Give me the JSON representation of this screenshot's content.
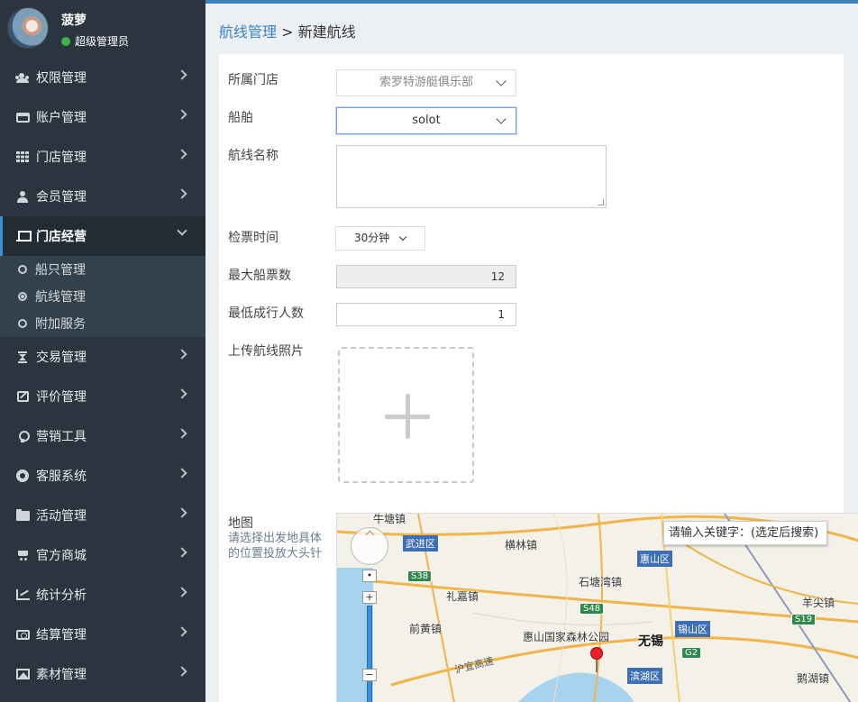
{
  "profile": {
    "name": "菠萝",
    "role": "超级管理员"
  },
  "sidebar": {
    "items": [
      {
        "label": "权限管理",
        "icon": "users-icon"
      },
      {
        "label": "账户管理",
        "icon": "card-icon"
      },
      {
        "label": "门店管理",
        "icon": "grid-icon"
      },
      {
        "label": "会员管理",
        "icon": "user-icon"
      },
      {
        "label": "门店经营",
        "icon": "laptop-icon",
        "expanded": true
      },
      {
        "label": "交易管理",
        "icon": "hourglass-icon"
      },
      {
        "label": "评价管理",
        "icon": "edit-icon"
      },
      {
        "label": "营销工具",
        "icon": "bulb-icon"
      },
      {
        "label": "客服系统",
        "icon": "lifebuoy-icon"
      },
      {
        "label": "活动管理",
        "icon": "folder-icon"
      },
      {
        "label": "官方商城",
        "icon": "cart-icon"
      },
      {
        "label": "统计分析",
        "icon": "chart-icon"
      },
      {
        "label": "结算管理",
        "icon": "money-icon"
      },
      {
        "label": "素材管理",
        "icon": "image-icon"
      }
    ],
    "subitems": [
      {
        "label": "船只管理",
        "selected": false
      },
      {
        "label": "航线管理",
        "selected": true
      },
      {
        "label": "附加服务",
        "selected": false
      }
    ]
  },
  "breadcrumb": {
    "parent": "航线管理",
    "separator": ">",
    "current": "新建航线"
  },
  "form": {
    "store": {
      "label": "所属门店",
      "value": "索罗特游艇俱乐部"
    },
    "boat": {
      "label": "船舶",
      "value": "solot"
    },
    "route_name": {
      "label": "航线名称",
      "value": ""
    },
    "check_time": {
      "label": "检票时间",
      "value": "30分钟"
    },
    "max_tickets": {
      "label": "最大船票数",
      "value": "12"
    },
    "min_people": {
      "label": "最低成行人数",
      "value": "1"
    },
    "photo": {
      "label": "上传航线照片"
    },
    "map": {
      "label": "地图",
      "hint": "请选择出发地具体的位置投放大头针"
    }
  },
  "map": {
    "search_placeholder": "请输入关键字：(选定后搜索)",
    "labels": [
      "牛塘镇",
      "横林镇",
      "石塘湾镇",
      "礼嘉镇",
      "前黄镇",
      "惠山国家森林公园",
      "无锡",
      "羊尖镇",
      "鹅湖镇"
    ],
    "districts": [
      "武进区",
      "惠山区",
      "锡山区",
      "滨湖区"
    ],
    "shields": [
      "S38",
      "S48",
      "S19",
      "G2"
    ],
    "road": "沪宜高速",
    "zoom_in": "+",
    "zoom_out": "−"
  },
  "colors": {
    "sidebar_bg": "#2a353f",
    "accent": "#3a82c4",
    "pin": "#e8202a"
  }
}
